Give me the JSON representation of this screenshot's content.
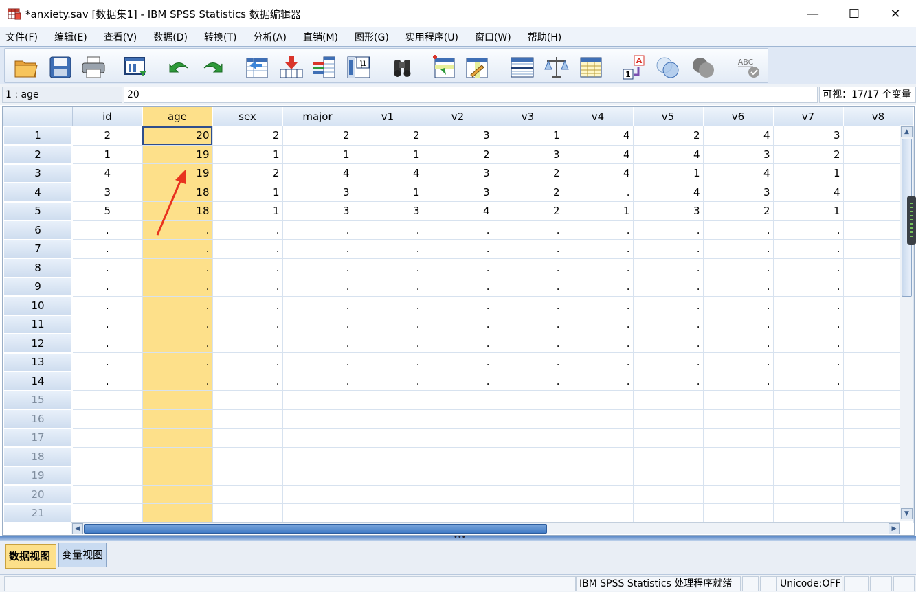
{
  "window": {
    "title": "*anxiety.sav [数据集1] - IBM SPSS Statistics 数据编辑器",
    "minimize": "—",
    "maximize": "☐",
    "close": "✕"
  },
  "menu": [
    "文件(F)",
    "编辑(E)",
    "查看(V)",
    "数据(D)",
    "转换(T)",
    "分析(A)",
    "直销(M)",
    "图形(G)",
    "实用程序(U)",
    "窗口(W)",
    "帮助(H)"
  ],
  "toolbar_icons": [
    "open-folder-icon",
    "save-icon",
    "print-icon",
    "recall-dialog-icon",
    "undo-icon",
    "redo-icon",
    "goto-case-icon",
    "goto-variable-icon",
    "variables-icon",
    "run-descriptive-icon",
    "find-icon",
    "insert-cases-icon",
    "insert-variable-icon",
    "split-file-icon",
    "weight-cases-icon",
    "select-cases-icon",
    "value-labels-icon",
    "use-sets-icon",
    "show-all-variables-icon",
    "spell-check-icon"
  ],
  "cell_editor": {
    "reference": "1 : age",
    "value": "20",
    "visible": "可视：17/17 个变量"
  },
  "grid": {
    "columns": [
      "id",
      "age",
      "sex",
      "major",
      "v1",
      "v2",
      "v3",
      "v4",
      "v5",
      "v6",
      "v7",
      "v8"
    ],
    "row_numbers": [
      "1",
      "2",
      "3",
      "4",
      "5",
      "6",
      "7",
      "8",
      "9",
      "10",
      "11",
      "12",
      "13",
      "14",
      "15",
      "16",
      "17",
      "18",
      "19",
      "20",
      "21"
    ],
    "rows": [
      [
        "2",
        "20",
        "2",
        "2",
        "2",
        "3",
        "1",
        "4",
        "2",
        "4",
        "3",
        ""
      ],
      [
        "1",
        "19",
        "1",
        "1",
        "1",
        "2",
        "3",
        "4",
        "4",
        "3",
        "2",
        ""
      ],
      [
        "4",
        "19",
        "2",
        "4",
        "4",
        "3",
        "2",
        "4",
        "1",
        "4",
        "1",
        ""
      ],
      [
        "3",
        "18",
        "1",
        "3",
        "1",
        "3",
        "2",
        ".",
        "4",
        "3",
        "4",
        ""
      ],
      [
        "5",
        "18",
        "1",
        "3",
        "3",
        "4",
        "2",
        "1",
        "3",
        "2",
        "1",
        ""
      ],
      [
        ".",
        ".",
        ".",
        ".",
        ".",
        ".",
        ".",
        ".",
        ".",
        ".",
        ".",
        ""
      ],
      [
        ".",
        ".",
        ".",
        ".",
        ".",
        ".",
        ".",
        ".",
        ".",
        ".",
        ".",
        ""
      ],
      [
        ".",
        ".",
        ".",
        ".",
        ".",
        ".",
        ".",
        ".",
        ".",
        ".",
        ".",
        ""
      ],
      [
        ".",
        ".",
        ".",
        ".",
        ".",
        ".",
        ".",
        ".",
        ".",
        ".",
        ".",
        ""
      ],
      [
        ".",
        ".",
        ".",
        ".",
        ".",
        ".",
        ".",
        ".",
        ".",
        ".",
        ".",
        ""
      ],
      [
        ".",
        ".",
        ".",
        ".",
        ".",
        ".",
        ".",
        ".",
        ".",
        ".",
        ".",
        ""
      ],
      [
        ".",
        ".",
        ".",
        ".",
        ".",
        ".",
        ".",
        ".",
        ".",
        ".",
        ".",
        ""
      ],
      [
        ".",
        ".",
        ".",
        ".",
        ".",
        ".",
        ".",
        ".",
        ".",
        ".",
        ".",
        ""
      ],
      [
        ".",
        ".",
        ".",
        ".",
        ".",
        ".",
        ".",
        ".",
        ".",
        ".",
        ".",
        ""
      ],
      [
        "",
        "",
        "",
        "",
        "",
        "",
        "",
        "",
        "",
        "",
        "",
        ""
      ],
      [
        "",
        "",
        "",
        "",
        "",
        "",
        "",
        "",
        "",
        "",
        "",
        ""
      ],
      [
        "",
        "",
        "",
        "",
        "",
        "",
        "",
        "",
        "",
        "",
        "",
        ""
      ],
      [
        "",
        "",
        "",
        "",
        "",
        "",
        "",
        "",
        "",
        "",
        "",
        ""
      ],
      [
        "",
        "",
        "",
        "",
        "",
        "",
        "",
        "",
        "",
        "",
        "",
        ""
      ],
      [
        "",
        "",
        "",
        "",
        "",
        "",
        "",
        "",
        "",
        "",
        "",
        ""
      ],
      [
        "",
        "",
        "",
        "",
        "",
        "",
        "",
        "",
        "",
        "",
        "",
        ""
      ]
    ],
    "filled_rows": 14,
    "selected_column": "age",
    "active_cell": "1 : age"
  },
  "tabs": {
    "data_view": "数据视图",
    "variable_view": "变量视图"
  },
  "status": {
    "processor": "IBM SPSS Statistics 处理程序就绪",
    "unicode": "Unicode:OFF"
  },
  "colors": {
    "selected_column": "#fde08a",
    "header_blue": "#d6e3f3",
    "annotation_arrow": "#e8321e"
  }
}
